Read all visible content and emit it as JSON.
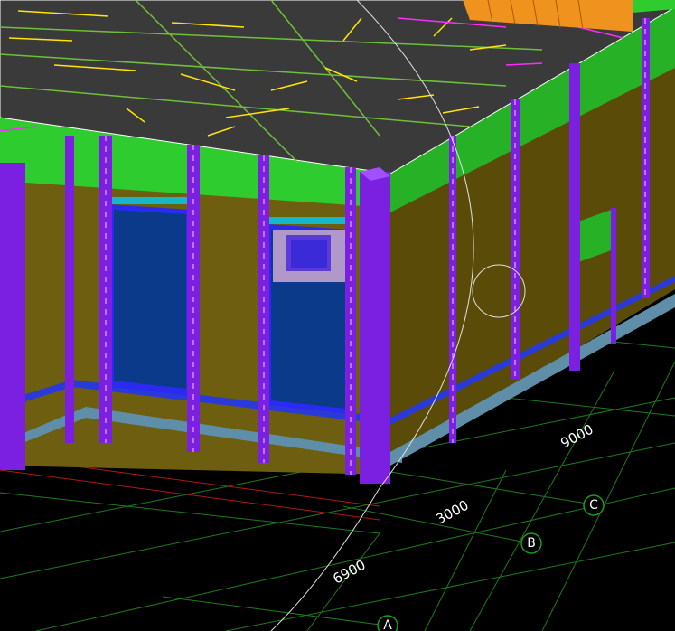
{
  "viewport": {
    "background": "#000000",
    "view_type": "3D model viewport"
  },
  "colors": {
    "roof": "#3a3a3a",
    "roof_edge": "#ffffff",
    "parapet": "#2ecc2e",
    "wall": "#6e5e10",
    "wall_shade": "#5a4c08",
    "column": "#7b1fe0",
    "column_dark": "#5a12b0",
    "window_glass": "#0b3a8a",
    "window_frame": "#2a2af0",
    "lintel": "#14b8c8",
    "slab_edge": "#5f8fa8",
    "band": "#2a3ad8",
    "grid_green": "#1e7a1e",
    "grid_red": "#b01818",
    "yellow_lines": "#ffe600",
    "magenta_lines": "#ff2cff",
    "stairs": "#f0921e"
  },
  "grid_bubbles": {
    "a": "A",
    "b": "B",
    "c": "C"
  },
  "dimensions": {
    "d1": "9000",
    "d2": "3000",
    "d3": "6900"
  },
  "nav_control": {
    "icon": "orbit-ring-icon"
  }
}
